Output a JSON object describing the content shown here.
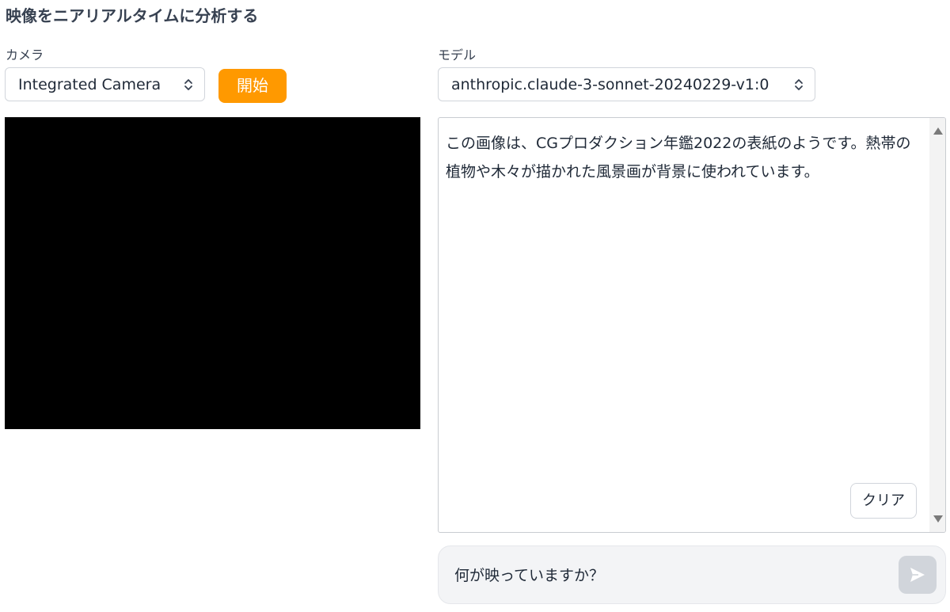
{
  "header": {
    "title": "映像をニアリアルタイムに分析する"
  },
  "camera": {
    "label": "カメラ",
    "selected": "Integrated Camera",
    "icon": "chevron-updown-icon"
  },
  "start_button": {
    "label": "開始",
    "color": "#ff9900"
  },
  "model": {
    "label": "モデル",
    "selected": "anthropic.claude-3-sonnet-20240229-v1:0",
    "icon": "chevron-updown-icon"
  },
  "response": {
    "text": "この画像は、CGプロダクション年鑑2022の表紙のようです。熱帯の植物や木々が描かれた風景画が背景に使われています。",
    "clear_label": "クリア"
  },
  "prompt": {
    "value": "何が映っていますか？",
    "send_icon": "send-icon"
  },
  "colors": {
    "accent": "#ff9900",
    "video_background": "#000000",
    "prompt_background": "#f3f4f6",
    "send_button_background": "#d1d5db"
  }
}
